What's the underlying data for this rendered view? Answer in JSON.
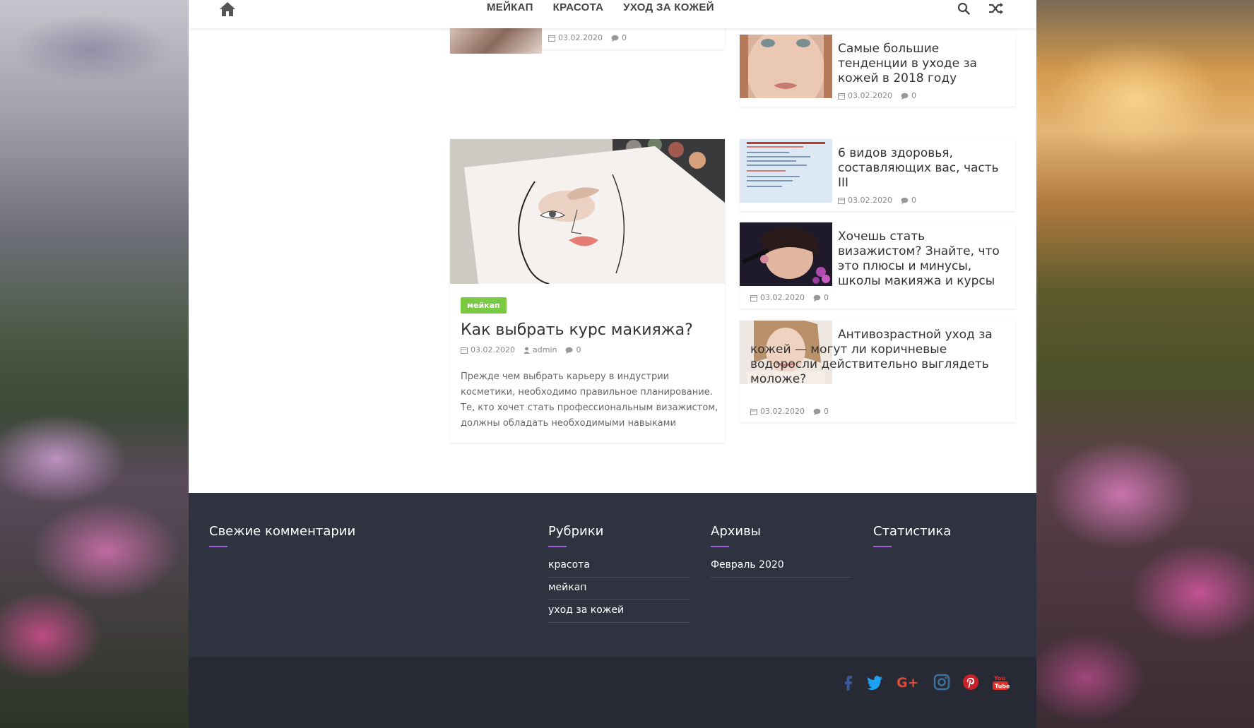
{
  "nav": {
    "items": [
      "МЕЙКАП",
      "КРАСОТА",
      "УХОД ЗА КОЖЕЙ"
    ]
  },
  "top_card": {
    "date": "03.02.2020",
    "comments": "0"
  },
  "sidebar_posts": [
    {
      "title": "Самые большие тенденции в уходе за кожей в 2018 году",
      "date": "03.02.2020",
      "comments": "0"
    },
    {
      "title": "6 видов здоровья, составляющих вас, часть III",
      "date": "03.02.2020",
      "comments": "0"
    },
    {
      "title": "Хочешь стать визажистом? Знайте, что это плюсы и минусы, школы макияжа и курсы",
      "date": "03.02.2020",
      "comments": "0"
    },
    {
      "title": "Антивозрастной уход за кожей — могут ли коричневые водоросли действительно выглядеть моложе?",
      "date": "03.02.2020",
      "comments": "0"
    }
  ],
  "featured_post": {
    "tag": "мейкап",
    "title": "Как выбрать курс макияжа?",
    "date": "03.02.2020",
    "author": "admin",
    "comments": "0",
    "excerpt": "Прежде чем выбрать карьеру в индустрии косметики, необходимо правильное планирование. Те, кто хочет стать профессиональным визажистом, должны обладать необходимыми навыками"
  },
  "footer": {
    "recent_comments_title": "Свежие комментарии",
    "categories_title": "Рубрики",
    "categories": [
      "красота",
      "мейкап",
      "уход за кожей"
    ],
    "archives_title": "Архивы",
    "archives": [
      "Февраль 2020"
    ],
    "stats_title": "Статистика"
  },
  "social": [
    "facebook-icon",
    "twitter-icon",
    "google-plus-icon",
    "instagram-icon",
    "pinterest-icon",
    "youtube-icon"
  ],
  "colors": {
    "accent": "#a15fd6",
    "tag_green": "#7ac943",
    "footer_bg": "#2f323f",
    "footer_bottom_bg": "#272935",
    "facebook": "#3b5998",
    "twitter": "#1da1f2",
    "google_plus": "#dd4b39",
    "instagram": "#3f729b",
    "pinterest": "#cb2027",
    "youtube": "#e52d27"
  }
}
